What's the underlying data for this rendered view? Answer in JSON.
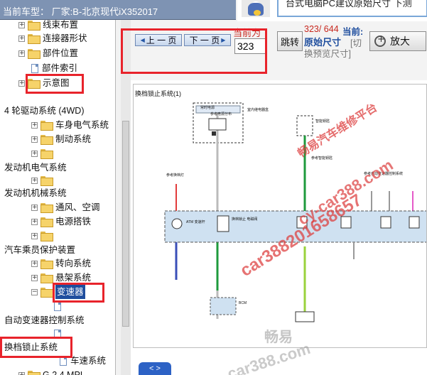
{
  "window": {
    "title": "当前车型：  厂家:B-北京现代iX352017"
  },
  "tree": {
    "items": [
      {
        "label": "线束布置",
        "expander": "+",
        "icon": "folder-icon"
      },
      {
        "label": "连接器形状",
        "expander": "+",
        "icon": "folder-icon"
      },
      {
        "label": "部件位置",
        "expander": "+",
        "icon": "folder-icon"
      },
      {
        "label": "部件索引",
        "expander": "",
        "icon": "document-icon"
      },
      {
        "label": "示意图",
        "expander": "+",
        "icon": "folder-icon"
      },
      {
        "label": "4 轮驱动系统 (4WD)",
        "expander": "",
        "icon": ""
      },
      {
        "label": "车身电气系统",
        "expander": "+",
        "icon": "folder-icon"
      },
      {
        "label": "制动系统",
        "expander": "+",
        "icon": "folder-icon"
      },
      {
        "label": "",
        "expander": "+",
        "icon": "folder-icon"
      },
      {
        "label": "发动机电气系统",
        "expander": "",
        "icon": ""
      },
      {
        "label": "",
        "expander": "+",
        "icon": "folder-icon"
      },
      {
        "label": "发动机机械系统",
        "expander": "",
        "icon": ""
      },
      {
        "label": "通风、空调",
        "expander": "+",
        "icon": "folder-icon"
      },
      {
        "label": "电源搭铁",
        "expander": "+",
        "icon": "folder-icon"
      },
      {
        "label": "",
        "expander": "+",
        "icon": "folder-icon"
      },
      {
        "label": "汽车乘员保护装置",
        "expander": "",
        "icon": ""
      },
      {
        "label": "转向系统",
        "expander": "+",
        "icon": "folder-icon"
      },
      {
        "label": "悬架系统",
        "expander": "+",
        "icon": "folder-icon"
      },
      {
        "label": "变速器",
        "expander": "−",
        "icon": "folder-icon",
        "selected": true
      },
      {
        "label": "",
        "expander": "",
        "icon": "document-icon"
      },
      {
        "label": "自动变速器控制系统",
        "expander": "",
        "icon": ""
      },
      {
        "label": "",
        "expander": "",
        "icon": "document-icon"
      },
      {
        "label": "换档锁止系统",
        "expander": "",
        "icon": ""
      },
      {
        "label": "车速系统",
        "expander": "",
        "icon": "document-icon"
      },
      {
        "label": "G 2.4 MPI",
        "expander": "+",
        "icon": "folder-icon"
      }
    ]
  },
  "toolbar": {
    "prev_label": "上 一 页",
    "next_label": "下 一 页",
    "current_page_label": "当前为",
    "page_input_value": "323",
    "jump_label": "跳转",
    "page_status": "323/ 644",
    "current_label": "当前:",
    "original_size": "原始尺寸",
    "switch_hint_1": "[切",
    "switch_hint_2": "换预览尺寸]",
    "zoom_label": "放大"
  },
  "ad_banner": {
    "text": "台式电脑PC建议原始尺寸 下测"
  },
  "diagram": {
    "title": "换档锁止系统(1)",
    "labels": [
      "常时电源",
      "室内继电器盒",
      "参考电源分布",
      "模块1",
      "参考室内继电器分布",
      "智能钥匙",
      "参考智能钥匙",
      "参考换档灯",
      "参考自动变速器控制系统",
      "ATM 变速杆",
      "换档锁止 电磁阀",
      "P 开关",
      "参考搭铁分布",
      "BCM",
      "换档锁止 继电器"
    ],
    "watermarks": [
      "畅易汽车维修平台",
      "cy-car388.com",
      "car388201658657",
      "畅易",
      "car388.com"
    ]
  },
  "bottom_tab": {
    "label": "< >"
  },
  "colors": {
    "titlebar": "#7e93b3",
    "highlight_box": "#e8232b",
    "selection": "#1f4e9e",
    "watermark": "#e23b3b"
  }
}
